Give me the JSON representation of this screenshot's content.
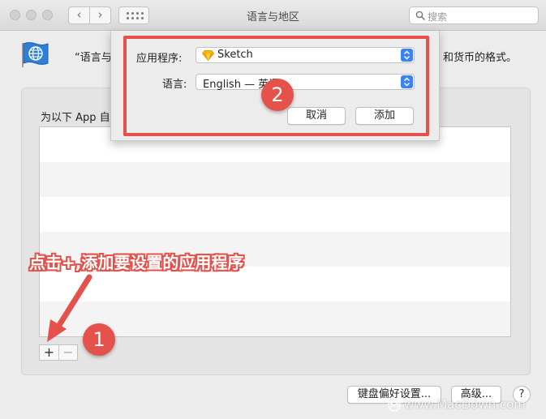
{
  "window": {
    "title": "语言与地区",
    "search_placeholder": "搜索"
  },
  "header": {
    "description_left": "“语言与",
    "description_right": "和货币的格式。"
  },
  "group": {
    "label": "为以下 App 自定"
  },
  "list_controls": {
    "plus": "+",
    "minus": "−"
  },
  "footer": {
    "keyboard_button": "键盘偏好设置...",
    "advanced_button": "高级...",
    "help_button": "?"
  },
  "sheet": {
    "app_label": "应用程序:",
    "app_value": "Sketch",
    "language_label": "语言:",
    "language_value": "English — 英语",
    "cancel_button": "取消",
    "add_button": "添加"
  },
  "annotations": {
    "badge1": "1",
    "badge2": "2",
    "callout": "点击+,添加要设置的应用程序"
  },
  "watermark": "www.MacDown.com",
  "colors": {
    "accent_red": "#e5514b",
    "stepper_blue": "#3b82f6"
  }
}
